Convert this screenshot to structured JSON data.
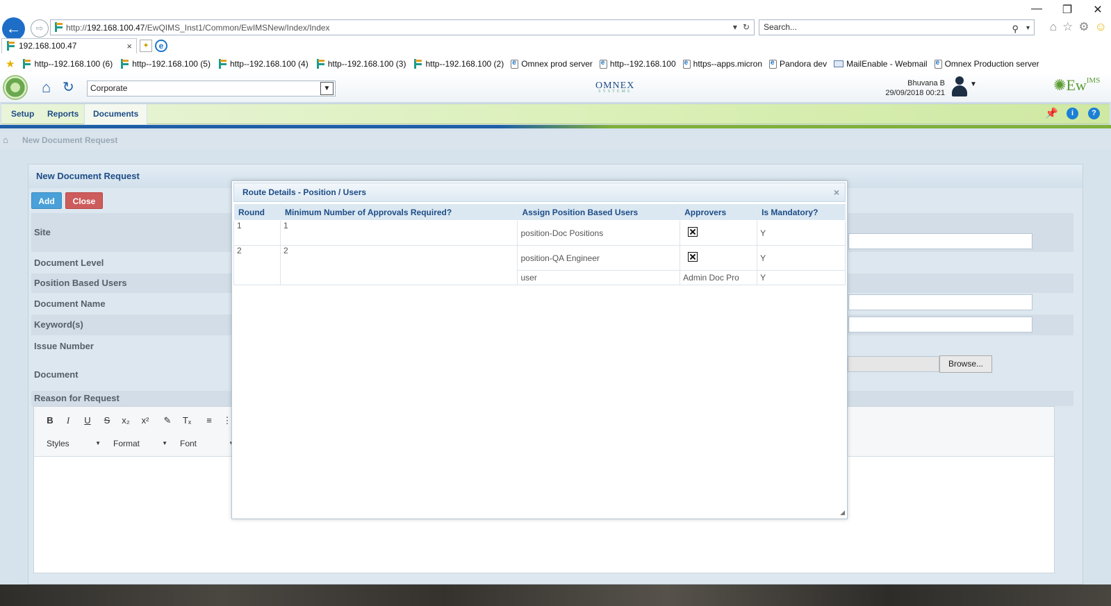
{
  "browser": {
    "url_prefix": "http://",
    "url_host": "192.168.100.47",
    "url_path": "/EwQIMS_Inst1/Common/EwIMSNew/Index/Index",
    "search_placeholder": "Search...",
    "tab_title": "192.168.100.47",
    "favorites": [
      {
        "label": "http--192.168.100 (6)",
        "icon": "e-logo"
      },
      {
        "label": "http--192.168.100 (5)",
        "icon": "e-logo"
      },
      {
        "label": "http--192.168.100 (4)",
        "icon": "e-logo"
      },
      {
        "label": "http--192.168.100 (3)",
        "icon": "e-logo"
      },
      {
        "label": "http--192.168.100 (2)",
        "icon": "e-logo"
      },
      {
        "label": "Omnex prod server",
        "icon": "ie-page"
      },
      {
        "label": "http--192.168.100",
        "icon": "ie-page"
      },
      {
        "label": "https--apps.micron",
        "icon": "ie-page"
      },
      {
        "label": "Pandora dev",
        "icon": "ie-page"
      },
      {
        "label": "MailEnable - Webmail",
        "icon": "mail"
      },
      {
        "label": "Omnex Production server",
        "icon": "ie-page"
      }
    ]
  },
  "app": {
    "site_value": "Corporate",
    "center_logo": "OMNEX",
    "center_logo_sub": "SYSTEMS",
    "user_name": "Bhuvana B",
    "datetime": "29/09/2018 00:21",
    "brand": "Ew",
    "brand_sup": "IMS",
    "menu": {
      "setup": "Setup",
      "reports": "Reports",
      "documents": "Documents"
    },
    "breadcrumb": "New Document Request"
  },
  "form": {
    "title": "New Document Request",
    "add_label": "Add",
    "close_label": "Close",
    "labels": {
      "site": "Site",
      "document_level": "Document Level",
      "position_based_users": "Position Based Users",
      "document_name": "Document Name",
      "keywords": "Keyword(s)",
      "issue_number": "Issue Number",
      "document": "Document",
      "reason": "Reason for Request"
    },
    "browse_label": "Browse...",
    "editor": {
      "styles": "Styles",
      "format": "Format",
      "font": "Font"
    }
  },
  "modal": {
    "title": "Route Details - Position / Users",
    "headers": {
      "round": "Round",
      "min_approvals": "Minimum Number of Approvals Required?",
      "assign": "Assign Position Based Users",
      "approvers": "Approvers",
      "mandatory": "Is Mandatory?"
    },
    "rows": [
      {
        "round": "1",
        "min": "1",
        "assign": "position-Doc Positions",
        "approver": "",
        "mandatory": "Y"
      },
      {
        "round": "2",
        "min": "2",
        "assign": "position-QA Engineer",
        "approver": "",
        "mandatory": "Y"
      },
      {
        "assign": "user",
        "approver": "Admin Doc Pro",
        "mandatory": "Y"
      }
    ]
  }
}
